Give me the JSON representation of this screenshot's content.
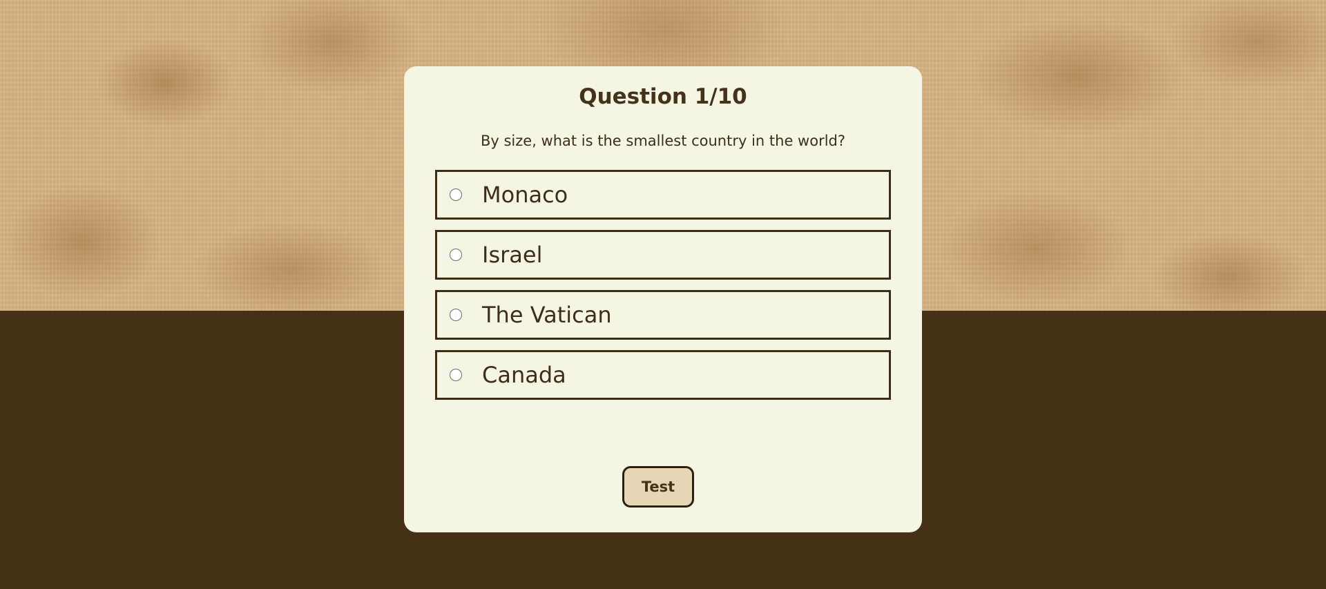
{
  "quiz": {
    "title": "Question 1/10",
    "question": "By size, what is the smallest country in the world?",
    "options": [
      {
        "label": "Monaco"
      },
      {
        "label": "Israel"
      },
      {
        "label": "The Vatican"
      },
      {
        "label": "Canada"
      }
    ],
    "button_label": "Test"
  },
  "colors": {
    "card_background": "#f4f5e3",
    "page_dark": "#453116",
    "text": "#45321a",
    "button_background": "#e6d6b5",
    "parchment": "#d5b180"
  },
  "icons": {
    "option_marker": "radio-icon"
  }
}
